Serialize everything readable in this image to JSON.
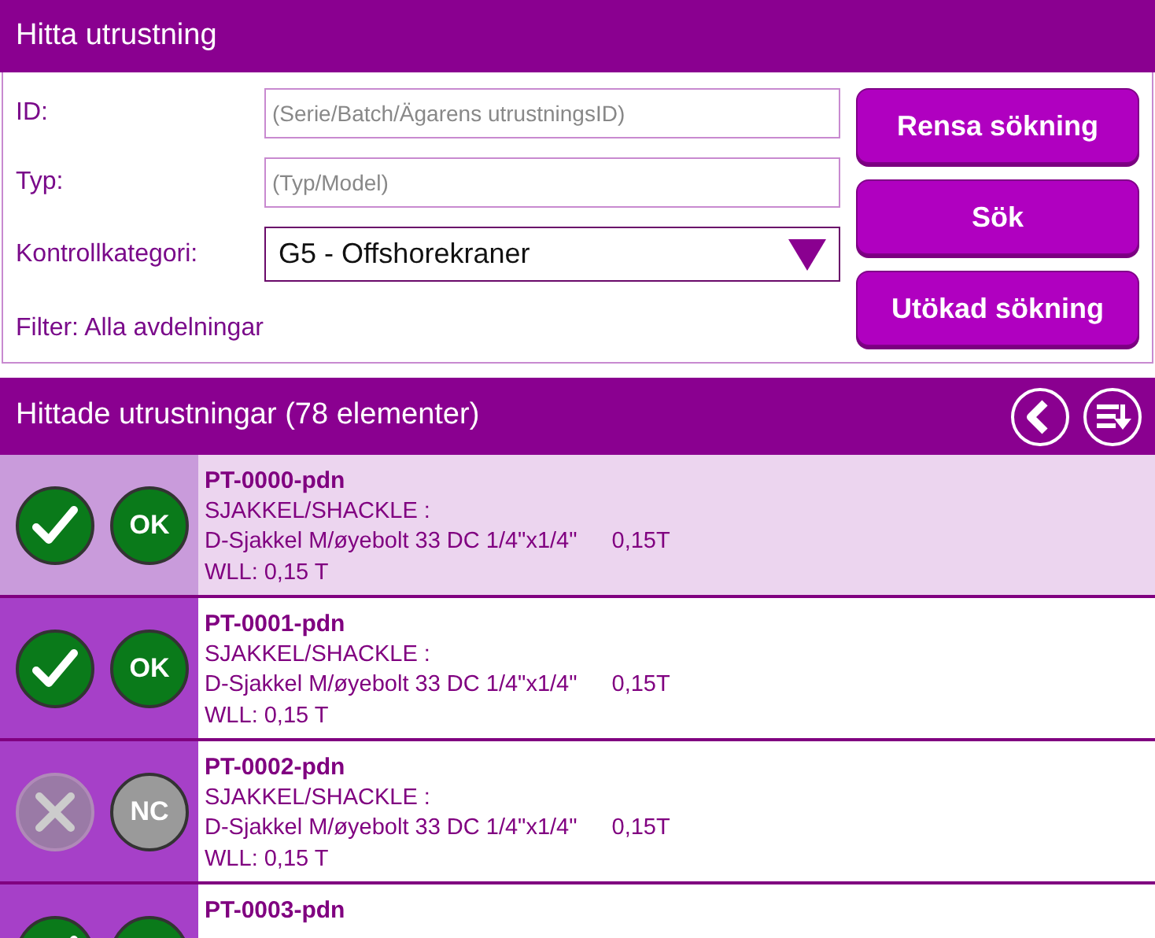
{
  "search_panel": {
    "title": "Hitta utrustning",
    "fields": [
      {
        "label": "ID:",
        "kind": "text",
        "placeholder": "(Serie/Batch/Ägarens utrustningsID)"
      },
      {
        "label": "Typ:",
        "kind": "text",
        "placeholder": "(Typ/Model)"
      },
      {
        "label": "Kontrollkategori:",
        "kind": "select",
        "value": "G5 - Offshorekraner"
      }
    ],
    "filter": "Filter: Alla avdelningar",
    "buttons": [
      "Rensa sökning",
      "Sök",
      "Utökad sökning"
    ]
  },
  "results": {
    "title": "Hittade utrustningar (78 elementer)",
    "rows": [
      {
        "id": "PT-0000-pdn",
        "kind": "ok",
        "badge": "OK",
        "selected": true,
        "category": "SJAKKEL/SHACKLE :",
        "description": "D-Sjakkel M/øyebolt 33 DC 1/4\"x1/4\"",
        "capacity": "0,15T",
        "wll": "WLL: 0,15 T"
      },
      {
        "id": "PT-0001-pdn",
        "kind": "ok",
        "badge": "OK",
        "selected": false,
        "category": "SJAKKEL/SHACKLE :",
        "description": "D-Sjakkel M/øyebolt 33 DC 1/4\"x1/4\"",
        "capacity": "0,15T",
        "wll": "WLL: 0,15 T"
      },
      {
        "id": "PT-0002-pdn",
        "kind": "nc",
        "badge": "NC",
        "selected": false,
        "category": "SJAKKEL/SHACKLE :",
        "description": "D-Sjakkel M/øyebolt 33 DC 1/4\"x1/4\"",
        "capacity": "0,15T",
        "wll": "WLL: 0,15 T"
      },
      {
        "id": "PT-0003-pdn",
        "kind": "ok",
        "selected": false
      }
    ]
  }
}
